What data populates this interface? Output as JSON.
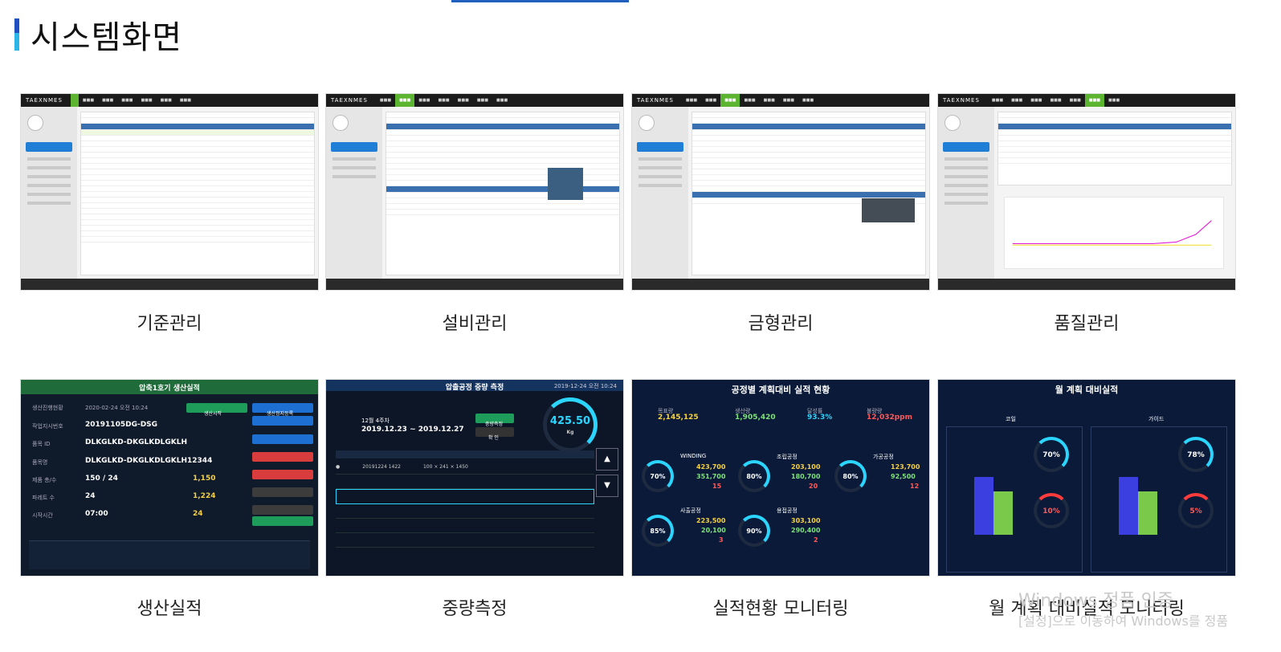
{
  "page": {
    "title": "시스템화면"
  },
  "screens": [
    {
      "caption": "기준관리",
      "nav_logo": "TAEXNMES"
    },
    {
      "caption": "설비관리",
      "nav_logo": "TAEXNMES"
    },
    {
      "caption": "금형관리",
      "nav_logo": "TAEXNMES"
    },
    {
      "caption": "품질관리",
      "nav_logo": "TAEXNMES"
    },
    {
      "caption": "생산실적",
      "title": "압축1호기 생산실적",
      "rows": [
        {
          "label": "생산진행현황",
          "value": "2020-02-24 오전 10:24"
        },
        {
          "label": "작업지시번호",
          "value": "20191105DG-DSG"
        },
        {
          "label": "품목 ID",
          "value": "DLKGLKD-DKGLKDLGKLH"
        },
        {
          "label": "품목명",
          "value": "DLKGLKD-DKGLKDLGKLH12344"
        },
        {
          "label": "제품 총/수",
          "value": "150 / 24"
        },
        {
          "label": "파레트 수",
          "value": "24"
        },
        {
          "label": "시작시간",
          "value": "07:00"
        }
      ],
      "right_values": [
        "1,150",
        "1,224",
        "24"
      ],
      "buttons": [
        "생산시작",
        "생산정지등록"
      ]
    },
    {
      "caption": "중량측정",
      "title": "압출공정 중량 측정",
      "datetime": "2019-12-24 오전 10:24",
      "week": "12월 4주차",
      "range": "2019.12.23 ~ 2019.12.27",
      "weight": "425.50",
      "unit": "Kg",
      "btn_save": "중량측정",
      "btn_ok": "확 인",
      "row_id": "20191224 1422",
      "row_spec": "100 × 241 × 1450"
    },
    {
      "caption": "실적현황 모니터링",
      "title": "공정별 계획대비 실적 현황",
      "kpis": [
        {
          "label": "목표량",
          "value": "2,145,125"
        },
        {
          "label": "생산량",
          "value": "1,905,420"
        },
        {
          "label": "달성률",
          "value": "93.3%"
        },
        {
          "label": "불량량",
          "value": "12,032ppm"
        }
      ],
      "processes": [
        {
          "name": "WINDING",
          "percent": 70,
          "values": [
            "423,700",
            "351,700",
            "15"
          ]
        },
        {
          "name": "조립공정",
          "percent": 80,
          "values": [
            "203,100",
            "180,700",
            "20"
          ]
        },
        {
          "name": "가공공정",
          "percent": 80,
          "values": [
            "123,700",
            "92,500",
            "12"
          ]
        },
        {
          "name": "사출공정",
          "percent": 85,
          "values": [
            "223,500",
            "20,100",
            "3"
          ]
        },
        {
          "name": "용접공정",
          "percent": 90,
          "values": [
            "303,100",
            "290,400",
            "2"
          ]
        }
      ]
    },
    {
      "caption": "월 계획 대비실적 모니터링",
      "title": "월 계획 대비실적",
      "panels": [
        {
          "name": "코일",
          "achieve": 70,
          "defect": 10,
          "bars": [
            3200,
            2800
          ]
        },
        {
          "name": "가이드",
          "achieve": 78,
          "defect": 5,
          "bars": [
            3200,
            2800
          ]
        }
      ]
    }
  ],
  "watermark": {
    "line1": "Windows 정품 인증",
    "line2": "[설정]으로 이동하여 Windows를 정품"
  },
  "colors": {
    "accent": "#1f5fbf",
    "green": "#5cb531",
    "cyan": "#2bd5ff"
  }
}
